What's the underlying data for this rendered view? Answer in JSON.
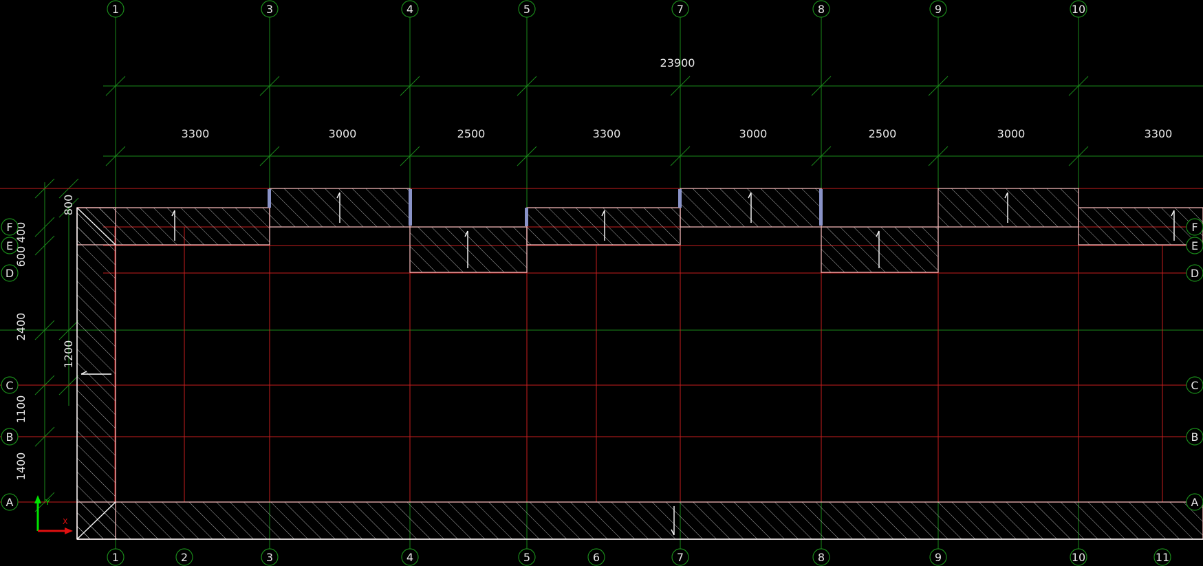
{
  "top_axes": [
    "1",
    "3",
    "4",
    "5",
    "7",
    "8",
    "9",
    "10"
  ],
  "bottom_axes": [
    "1",
    "2",
    "3",
    "4",
    "5",
    "6",
    "7",
    "8",
    "9",
    "10",
    "11"
  ],
  "row_axes": [
    "F",
    "E",
    "D",
    "C",
    "B",
    "A"
  ],
  "overall_dimension": "23900",
  "span_dimensions": [
    "3300",
    "3000",
    "2500",
    "3300",
    "3000",
    "2500",
    "3000",
    "3300"
  ],
  "outer_vertical_dimensions": [
    "400",
    "600",
    "2400",
    "1100",
    "1400"
  ],
  "inner_vertical_dimensions": [
    "800",
    "1200"
  ],
  "ucs": {
    "x_label": "X",
    "y_label": "Y"
  },
  "colors": {
    "background": "#000000",
    "grid_green": "#1a8a1a",
    "axis_red": "#c81e1e",
    "slab_outline": "#f0b4b4",
    "hatch": "#d8d8d8",
    "column_marker": "#8a93c8",
    "text": "#e8e8e8"
  }
}
